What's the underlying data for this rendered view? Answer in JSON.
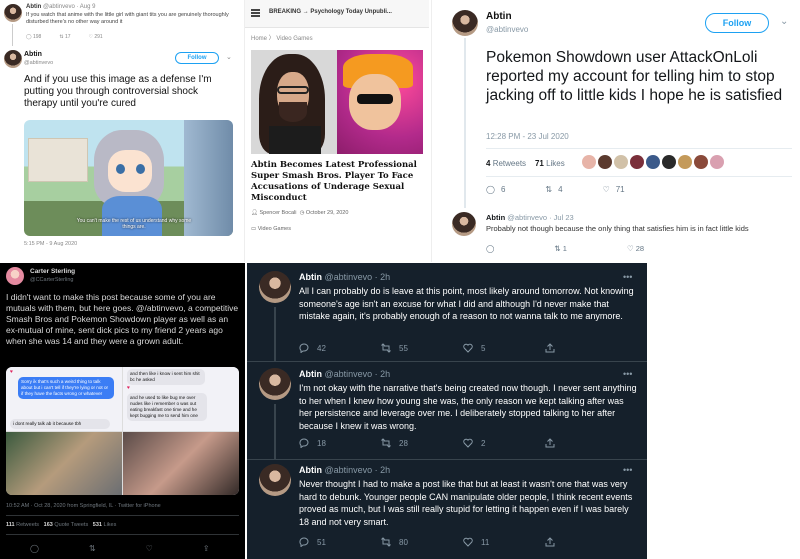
{
  "panel_a": {
    "quoted": {
      "name": "Abtin",
      "handle": "@abtinvevo · Aug 9",
      "text": "If you watch that anime with the little girl with giant tits you are genuinely thoroughly disturbed there's no other way around it",
      "replies": "198",
      "retweets": "17",
      "likes": "291"
    },
    "tweet": {
      "name": "Abtin",
      "handle": "@abtinvevo",
      "follow_label": "Follow",
      "text": "And if you use this image as a defense I'm putting you through controversial shock therapy until you're cured",
      "image_caption": "You can't make the rest of us understand why some things are.",
      "timestamp": "5:15 PM - 9 Aug 2020"
    }
  },
  "panel_b": {
    "breaking_label": "BREAKING",
    "arrow": "→",
    "breaking_headline": "Psychology Today Unpubli...",
    "breadcrumb": "Home   〉 Video Games",
    "title": "Abtin Becomes Latest Professional Super Smash Bros. Player To Face Accusations of Underage Sexual Misconduct",
    "author": "Spencer Bocali",
    "date": "October 29, 2020",
    "category": "Video Games"
  },
  "panel_c": {
    "name": "Abtin",
    "handle": "@abtinvevo",
    "follow_label": "Follow",
    "text": "Pokemon Showdown user AttackOnLoli reported my account for telling him to stop jacking off to little kids I hope he is satisfied",
    "timestamp": "12:28 PM - 23 Jul 2020",
    "retweets_count": "4",
    "retweets_label": "Retweets",
    "likes_count": "71",
    "likes_label": "Likes",
    "actions": {
      "replies": "6",
      "retweets": "4",
      "likes": "71"
    },
    "reply": {
      "name": "Abtin",
      "handle": "@abtinvevo · Jul 23",
      "text": "Probably not though because the only thing that satisfies him is in fact little kids",
      "retweets": "1",
      "likes": "28"
    }
  },
  "panel_d": {
    "name": "Carter Sterling",
    "handle": "@CCarterSterling",
    "text": "I didn't want to make this post because some of you are mutuals with them, but here goes. @/abtinvevo, a competitive Smash Bros and Pokemon Showdown player as well as an ex-mutual of mine, sent dick pics to my friend 2 years ago when she was 14 and they were a grown adult.",
    "chat_left_blue": "Sorry ik that's such a weird thing to talk about but i can't tell if they're lying or not or if they have the facts wrong or whatever",
    "chat_left_grey": "i dont really talk ab it because tbh",
    "chat_right_top": "and then like i know i sent him shit bc he asked",
    "chat_right_mid": "and he used to like bug me over nudes like i remember o was out eating breakfast one time and he kept bugging me to send him one",
    "timestamp": "10:52 AM · Oct 28, 2020 from Springfield, IL · Twitter for iPhone",
    "retweets": "111",
    "retweets_label": "Retweets",
    "quotes": "163",
    "quotes_label": "Quote Tweets",
    "likes": "531",
    "likes_label": "Likes"
  },
  "panel_e": {
    "tweets": [
      {
        "name": "Abtin",
        "meta": "@abtinvevo · 2h",
        "text": "All I can probably do is leave at this point, most likely around tomorrow. Not knowing someone's age isn't an excuse for what I did and although I'd never make that mistake again, it's probably enough of a reason to not wanna talk to me anymore.",
        "replies": "42",
        "retweets": "55",
        "likes": "5"
      },
      {
        "name": "Abtin",
        "meta": "@abtinvevo · 2h",
        "text": "I'm not okay with the narrative that's being created now though. I never sent anything to her when I knew how young she was, the only reason we kept talking after was her persistence and leverage over me. I deliberately stopped talking to her after because I knew it was wrong.",
        "replies": "18",
        "retweets": "28",
        "likes": "2"
      },
      {
        "name": "Abtin",
        "meta": "@abtinvevo · 2h",
        "text": "Never thought I had to make a post like that but at least it wasn't one that was very hard to debunk. Younger people CAN manipulate older people, I think recent events proved as much, but I was still really stupid for letting it happen even if I was barely 18 and not very smart.",
        "replies": "51",
        "retweets": "80",
        "likes": "11"
      }
    ],
    "more_glyph": "•••"
  },
  "colors": {
    "twitter_blue": "#1da1f2",
    "dim_bg": "#15202b",
    "black_bg": "#000000",
    "muted": "#8899a6"
  },
  "icons": [
    "reply-icon",
    "retweet-icon",
    "like-icon",
    "share-icon",
    "more-icon",
    "chevron-down-icon",
    "menu-icon",
    "user-icon",
    "clock-icon",
    "folder-icon"
  ]
}
